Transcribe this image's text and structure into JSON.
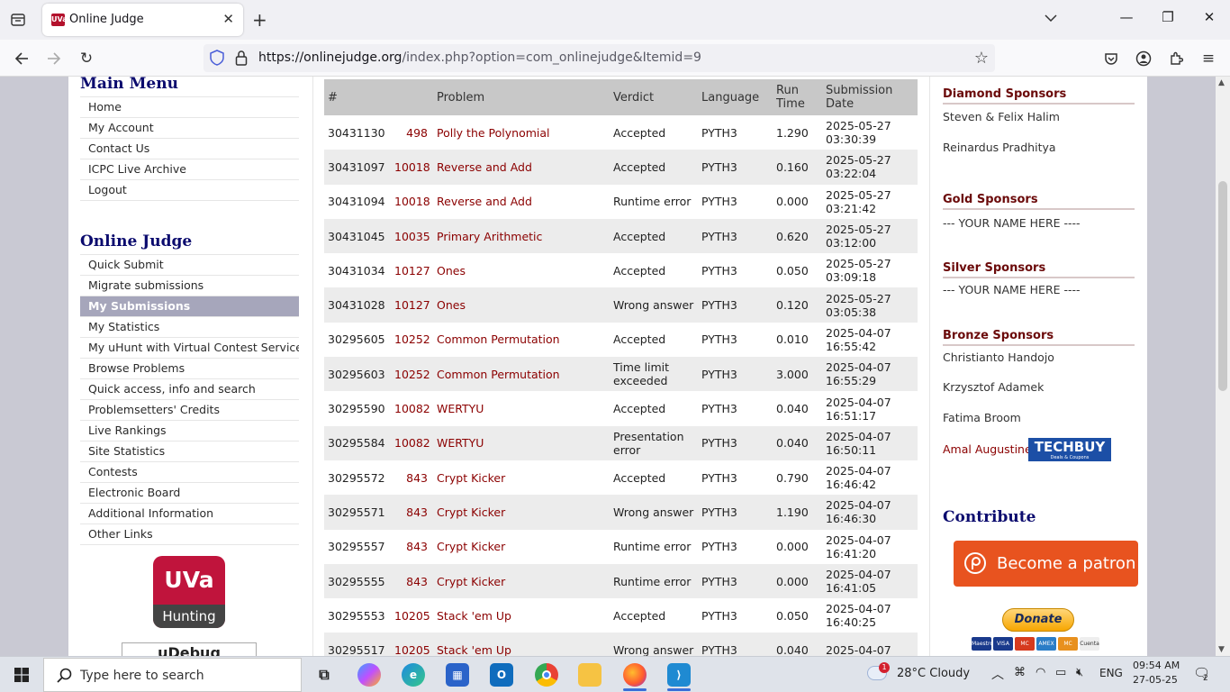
{
  "browser": {
    "tab_title": "Online Judge",
    "tab_favicon_text": "UVa",
    "url_host": "https://onlinejudge.org",
    "url_path": "/index.php?option=com_onlinejudge&Itemid=9"
  },
  "main_menu": {
    "heading": "Main Menu",
    "items": [
      "Home",
      "My Account",
      "Contact Us",
      "ICPC Live Archive",
      "Logout"
    ]
  },
  "judge_menu": {
    "heading": "Online Judge",
    "active_index": 2,
    "items": [
      "Quick Submit",
      "Migrate submissions",
      "My Submissions",
      "My Statistics",
      "My uHunt with Virtual Contest Service",
      "Browse Problems",
      "Quick access, info and search",
      "Problemsetters' Credits",
      "Live Rankings",
      "Site Statistics",
      "Contests",
      "Electronic Board",
      "Additional Information",
      "Other Links"
    ]
  },
  "uva_logo": {
    "top": "UVa",
    "bottom": "Hunting"
  },
  "udebug_text": "uDebug",
  "table": {
    "headers": {
      "num": "#",
      "problem": "Problem",
      "verdict": "Verdict",
      "language": "Language",
      "runtime_1": "Run",
      "runtime_2": "Time",
      "date_1": "Submission",
      "date_2": "Date"
    },
    "rows": [
      {
        "id": "30431130",
        "pnum": "498",
        "pname": "Polly the Polynomial",
        "verdict": "Accepted",
        "lang": "PYTH3",
        "time": "1.290",
        "date": "2025-05-27",
        "clock": "03:30:39"
      },
      {
        "id": "30431097",
        "pnum": "10018",
        "pname": "Reverse and Add",
        "verdict": "Accepted",
        "lang": "PYTH3",
        "time": "0.160",
        "date": "2025-05-27",
        "clock": "03:22:04"
      },
      {
        "id": "30431094",
        "pnum": "10018",
        "pname": "Reverse and Add",
        "verdict": "Runtime error",
        "lang": "PYTH3",
        "time": "0.000",
        "date": "2025-05-27",
        "clock": "03:21:42"
      },
      {
        "id": "30431045",
        "pnum": "10035",
        "pname": "Primary Arithmetic",
        "verdict": "Accepted",
        "lang": "PYTH3",
        "time": "0.620",
        "date": "2025-05-27",
        "clock": "03:12:00"
      },
      {
        "id": "30431034",
        "pnum": "10127",
        "pname": "Ones",
        "verdict": "Accepted",
        "lang": "PYTH3",
        "time": "0.050",
        "date": "2025-05-27",
        "clock": "03:09:18"
      },
      {
        "id": "30431028",
        "pnum": "10127",
        "pname": "Ones",
        "verdict": "Wrong answer",
        "lang": "PYTH3",
        "time": "0.120",
        "date": "2025-05-27",
        "clock": "03:05:38"
      },
      {
        "id": "30295605",
        "pnum": "10252",
        "pname": "Common Permutation",
        "verdict": "Accepted",
        "lang": "PYTH3",
        "time": "0.010",
        "date": "2025-04-07",
        "clock": "16:55:42"
      },
      {
        "id": "30295603",
        "pnum": "10252",
        "pname": "Common Permutation",
        "verdict": "Time limit exceeded",
        "lang": "PYTH3",
        "time": "3.000",
        "date": "2025-04-07",
        "clock": "16:55:29"
      },
      {
        "id": "30295590",
        "pnum": "10082",
        "pname": "WERTYU",
        "verdict": "Accepted",
        "lang": "PYTH3",
        "time": "0.040",
        "date": "2025-04-07",
        "clock": "16:51:17"
      },
      {
        "id": "30295584",
        "pnum": "10082",
        "pname": "WERTYU",
        "verdict": "Presentation error",
        "lang": "PYTH3",
        "time": "0.040",
        "date": "2025-04-07",
        "clock": "16:50:11"
      },
      {
        "id": "30295572",
        "pnum": "843",
        "pname": "Crypt Kicker",
        "verdict": "Accepted",
        "lang": "PYTH3",
        "time": "0.790",
        "date": "2025-04-07",
        "clock": "16:46:42"
      },
      {
        "id": "30295571",
        "pnum": "843",
        "pname": "Crypt Kicker",
        "verdict": "Wrong answer",
        "lang": "PYTH3",
        "time": "1.190",
        "date": "2025-04-07",
        "clock": "16:46:30"
      },
      {
        "id": "30295557",
        "pnum": "843",
        "pname": "Crypt Kicker",
        "verdict": "Runtime error",
        "lang": "PYTH3",
        "time": "0.000",
        "date": "2025-04-07",
        "clock": "16:41:20"
      },
      {
        "id": "30295555",
        "pnum": "843",
        "pname": "Crypt Kicker",
        "verdict": "Runtime error",
        "lang": "PYTH3",
        "time": "0.000",
        "date": "2025-04-07",
        "clock": "16:41:05"
      },
      {
        "id": "30295553",
        "pnum": "10205",
        "pname": "Stack 'em Up",
        "verdict": "Accepted",
        "lang": "PYTH3",
        "time": "0.050",
        "date": "2025-04-07",
        "clock": "16:40:25"
      },
      {
        "id": "30295517",
        "pnum": "10205",
        "pname": "Stack 'em Up",
        "verdict": "Wrong answer",
        "lang": "PYTH3",
        "time": "0.040",
        "date": "2025-04-07",
        "clock": ""
      }
    ]
  },
  "sponsors": {
    "diamond": {
      "heading": "Diamond Sponsors",
      "names": [
        "Steven & Felix Halim",
        "Reinardus Pradhitya"
      ]
    },
    "gold": {
      "heading": "Gold Sponsors",
      "names": [
        "--- YOUR NAME HERE ----"
      ]
    },
    "silver": {
      "heading": "Silver Sponsors",
      "names": [
        "--- YOUR NAME HERE ----"
      ]
    },
    "bronze": {
      "heading": "Bronze Sponsors",
      "names": [
        "Christianto Handojo",
        "Krzysztof Adamek",
        "Fatima Broom",
        "Amal Augustine"
      ]
    },
    "techbuy_logo": "TECHBUY",
    "techbuy_sub": "Deals & Coupons"
  },
  "contribute": {
    "heading": "Contribute",
    "patron_label": "Become a patron",
    "donate_label": "Donate",
    "cards": [
      "Maestro",
      "VISA",
      "MC",
      "AMEX",
      "MC",
      "Cuenta bancaria"
    ]
  },
  "taskbar": {
    "search_placeholder": "Type here to search",
    "weather": "28°C  Cloudy",
    "weather_badge": "1",
    "lang": "ENG",
    "time": "09:54 AM",
    "date": "27-05-25",
    "notif_count": "2"
  },
  "colors": {
    "problem_link": "#8b0000",
    "menu_heading": "#0b0b6e",
    "active_menu_bg": "#a6a6bb",
    "patron_orange": "#e8531f"
  }
}
